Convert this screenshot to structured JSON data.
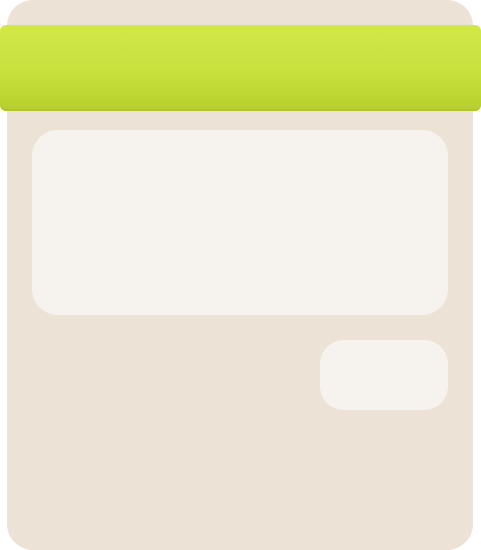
{
  "header": {
    "title": "",
    "accent_color": "#c8e13d"
  },
  "main": {
    "panel_text": ""
  },
  "actions": {
    "primary_label": ""
  },
  "colors": {
    "card_background": "#ede2d6",
    "panel_background": "#f6f3ef"
  }
}
